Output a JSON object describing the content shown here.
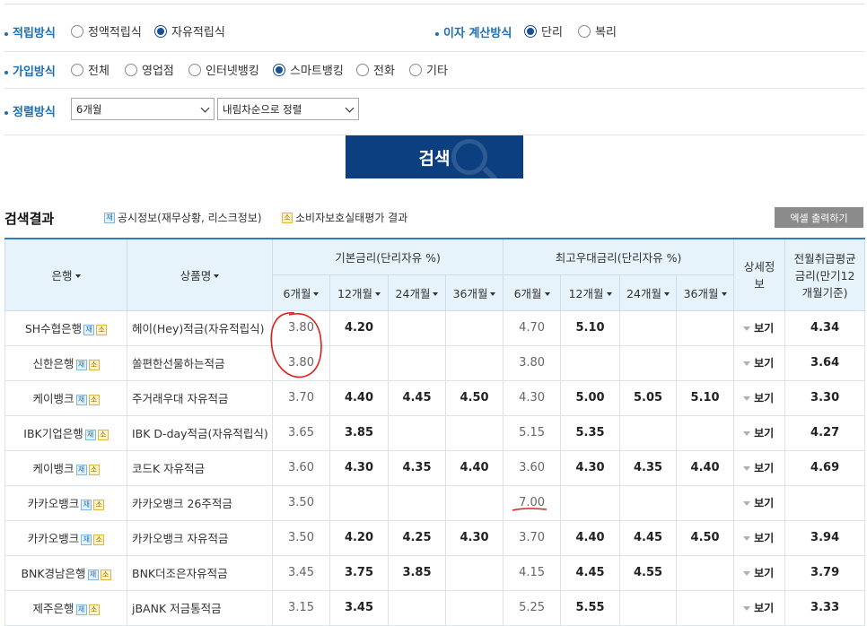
{
  "filters": {
    "savings_type": {
      "label": "적립방식",
      "options": [
        "정액적립식",
        "자유적립식"
      ],
      "selected": 1
    },
    "interest_type": {
      "label": "이자 계산방식",
      "options": [
        "단리",
        "복리"
      ],
      "selected": 0
    },
    "join_type": {
      "label": "가입방식",
      "options": [
        "전체",
        "영업점",
        "인터넷뱅킹",
        "스마트뱅킹",
        "전화",
        "기타"
      ],
      "selected": 3
    },
    "sort": {
      "label": "정렬방식",
      "period": "6개월",
      "order": "내림차순으로 정렬"
    }
  },
  "search_button": "검색",
  "results": {
    "title": "검색결과",
    "legend_jae": "공시정보(재무상황, 리스크정보)",
    "legend_so": "소비자보호실태평가 결과",
    "excel_button": "엑셀 출력하기",
    "badge_jae": "재",
    "badge_so": "소"
  },
  "table": {
    "headers": {
      "bank": "은행",
      "product": "상품명",
      "base_rate": "기본금리(단리자유 %)",
      "max_rate": "최고우대금리(단리자유 %)",
      "detail": "상세정보",
      "avg": "전월취급평균금리(만기12개월기준)",
      "periods": [
        "6개월",
        "12개월",
        "24개월",
        "36개월"
      ]
    },
    "detail_label": "보기",
    "rows": [
      {
        "bank": "SH수협은행",
        "product": "헤이(Hey)적금(자유적립식)",
        "base": [
          "3.80",
          "4.20",
          "",
          ""
        ],
        "max": [
          "4.70",
          "5.10",
          "",
          ""
        ],
        "avg": "4.34"
      },
      {
        "bank": "신한은행",
        "product": "쏠편한선물하는적금",
        "base": [
          "3.80",
          "",
          "",
          ""
        ],
        "max": [
          "3.80",
          "",
          "",
          ""
        ],
        "avg": "3.64"
      },
      {
        "bank": "케이뱅크",
        "product": "주거래우대 자유적금",
        "base": [
          "3.70",
          "4.40",
          "4.45",
          "4.50"
        ],
        "max": [
          "4.30",
          "5.00",
          "5.05",
          "5.10"
        ],
        "avg": "3.30"
      },
      {
        "bank": "IBK기업은행",
        "product": "IBK D-day적금(자유적립식)",
        "base": [
          "3.65",
          "3.85",
          "",
          ""
        ],
        "max": [
          "5.15",
          "5.35",
          "",
          ""
        ],
        "avg": "4.27"
      },
      {
        "bank": "케이뱅크",
        "product": "코드K 자유적금",
        "base": [
          "3.60",
          "4.30",
          "4.35",
          "4.40"
        ],
        "max": [
          "3.60",
          "4.30",
          "4.35",
          "4.40"
        ],
        "avg": "4.69"
      },
      {
        "bank": "카카오뱅크",
        "product": "카카오뱅크 26주적금",
        "base": [
          "3.50",
          "",
          "",
          ""
        ],
        "max": [
          "7.00",
          "",
          "",
          ""
        ],
        "avg": ""
      },
      {
        "bank": "카카오뱅크",
        "product": "카카오뱅크 자유적금",
        "base": [
          "3.50",
          "4.20",
          "4.25",
          "4.30"
        ],
        "max": [
          "3.70",
          "4.40",
          "4.45",
          "4.50"
        ],
        "avg": "3.94"
      },
      {
        "bank": "BNK경남은행",
        "product": "BNK더조은자유적금",
        "base": [
          "3.45",
          "3.75",
          "3.85",
          ""
        ],
        "max": [
          "4.15",
          "4.45",
          "4.55",
          ""
        ],
        "avg": "3.79"
      },
      {
        "bank": "제주은행",
        "product": "jBANK 저금통적금",
        "base": [
          "3.15",
          "3.45",
          "",
          ""
        ],
        "max": [
          "5.25",
          "5.55",
          "",
          ""
        ],
        "avg": "3.33"
      }
    ]
  },
  "colors": {
    "accent": "#1a6fb5",
    "button": "#0b3f7f",
    "header_bg": "#e6f3fb",
    "annotation": "#e0201b"
  }
}
